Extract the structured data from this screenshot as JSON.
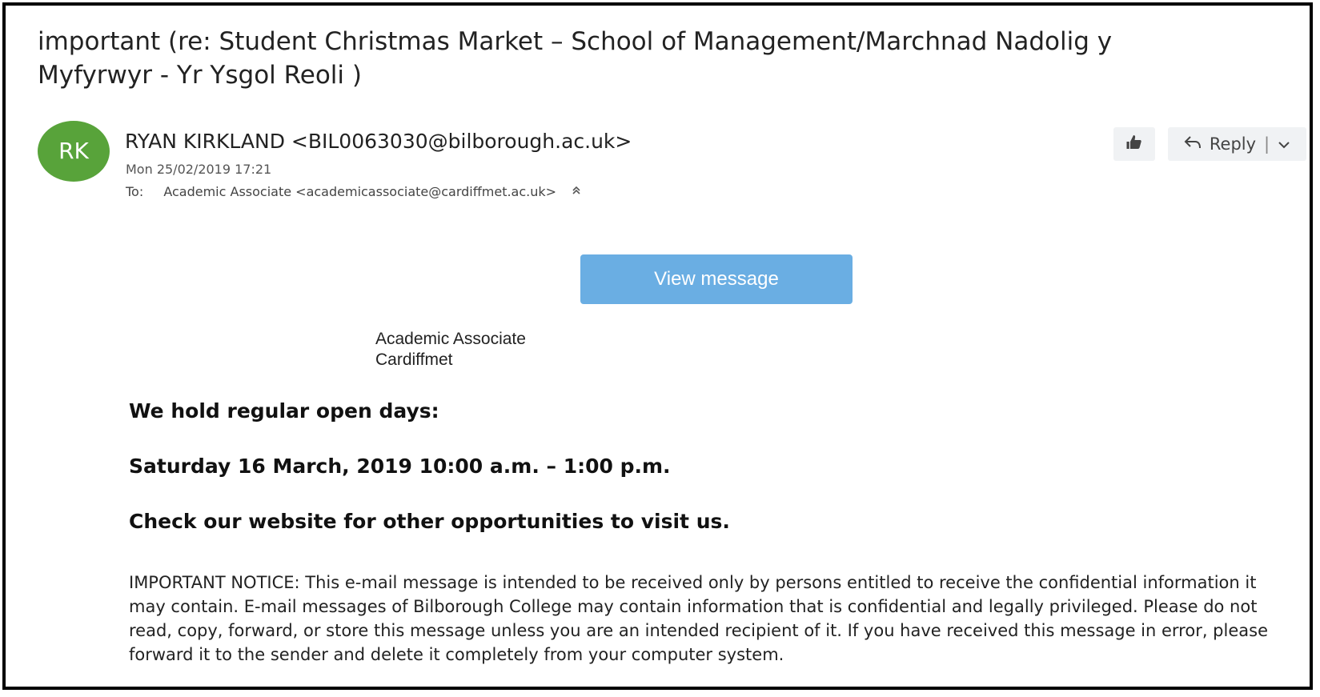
{
  "email": {
    "subject": "important (re: Student Christmas Market – School of Management/Marchnad Nadolig y Myfyrwyr - Yr Ysgol Reoli )",
    "sender": {
      "initials": "RK",
      "display": "RYAN KIRKLAND <BIL0063030@bilborough.ac.uk>",
      "avatar_color": "#58a33a"
    },
    "date": "Mon 25/02/2019 17:21",
    "to_label": "To:",
    "to_value": "Academic Associate <academicassociate@cardiffmet.ac.uk>",
    "actions": {
      "like_icon": "thumbs-up-icon",
      "reply_label": "Reply",
      "reply_icon": "reply-arrow-icon",
      "dropdown_icon": "chevron-down-icon"
    }
  },
  "body": {
    "view_button": "View message",
    "view_button_color": "#6aaee3",
    "signature_line1": "Academic Associate",
    "signature_line2": "Cardiffmet",
    "open_days_heading": "We hold regular open days:",
    "open_day_date": "Saturday 16 March, 2019 10:00 a.m. – 1:00 p.m.",
    "website_prompt": "Check our website for other opportunities to visit us.",
    "notice": "IMPORTANT NOTICE: This e-mail message is intended to be received only by persons entitled to receive the confidential information it may contain. E-mail messages of Bilborough College may contain information that is confidential and legally privileged. Please do not read, copy, forward, or store this message unless you are an intended recipient of it. If you have received this message in error, please forward it to the sender and delete it completely from your computer system."
  }
}
